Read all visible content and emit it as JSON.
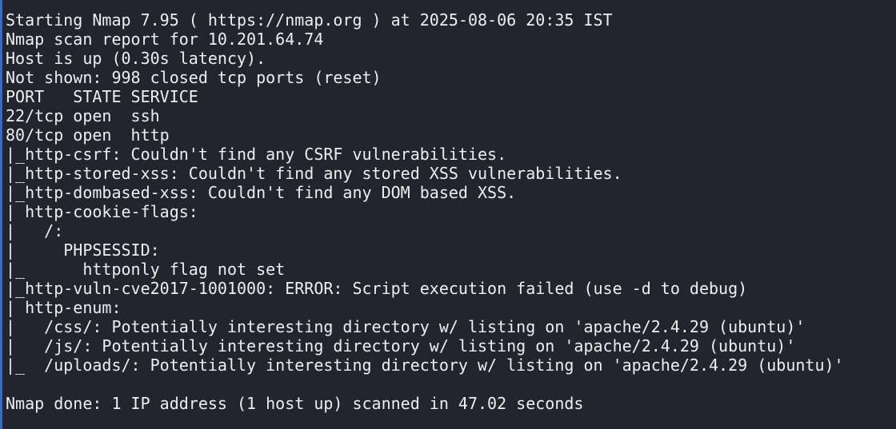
{
  "terminal": {
    "lines": [
      "Starting Nmap 7.95 ( https://nmap.org ) at 2025-08-06 20:35 IST",
      "Nmap scan report for 10.201.64.74",
      "Host is up (0.30s latency).",
      "Not shown: 998 closed tcp ports (reset)",
      "PORT   STATE SERVICE",
      "22/tcp open  ssh",
      "80/tcp open  http",
      "|_http-csrf: Couldn't find any CSRF vulnerabilities.",
      "|_http-stored-xss: Couldn't find any stored XSS vulnerabilities.",
      "|_http-dombased-xss: Couldn't find any DOM based XSS.",
      "| http-cookie-flags:",
      "|   /:",
      "|     PHPSESSID:",
      "|_      httponly flag not set",
      "|_http-vuln-cve2017-1001000: ERROR: Script execution failed (use -d to debug)",
      "| http-enum:",
      "|   /css/: Potentially interesting directory w/ listing on 'apache/2.4.29 (ubuntu)'",
      "|   /js/: Potentially interesting directory w/ listing on 'apache/2.4.29 (ubuntu)'",
      "|_  /uploads/: Potentially interesting directory w/ listing on 'apache/2.4.29 (ubuntu)'",
      "",
      "Nmap done: 1 IP address (1 host up) scanned in 47.02 seconds"
    ]
  },
  "colors": {
    "background": "#23252e",
    "text": "#eeeeee",
    "accent_edge": "#3c6cc0"
  }
}
